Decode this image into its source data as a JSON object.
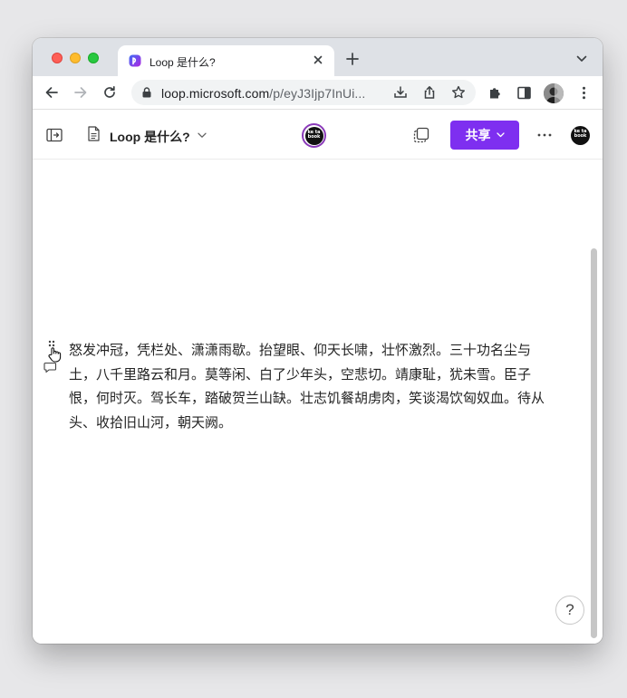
{
  "browser": {
    "tab": {
      "title": "Loop 是什么?",
      "favicon": "loop-icon"
    },
    "url": {
      "host": "loop.microsoft.com",
      "path": "/p/eyJ3Ijp7InUi..."
    }
  },
  "loop": {
    "doc_title": "Loop 是什么?",
    "share_label": "共享",
    "brand_logo_text": "ke ta book",
    "profile_logo_text": "ke ta book",
    "accent_color": "#7e2ff0"
  },
  "content": {
    "paragraph": "怒发冲冠，凭栏处、潇潇雨歇。抬望眼、仰天长啸，壮怀激烈。三十功名尘与土，八千里路云和月。莫等闲、白了少年头，空悲切。靖康耻，犹未雪。臣子恨，何时灭。驾长车，踏破贺兰山缺。壮志饥餐胡虏肉，笑谈渴饮匈奴血。待从头、收拾旧山河，朝天阙。"
  },
  "help": {
    "label": "?"
  }
}
